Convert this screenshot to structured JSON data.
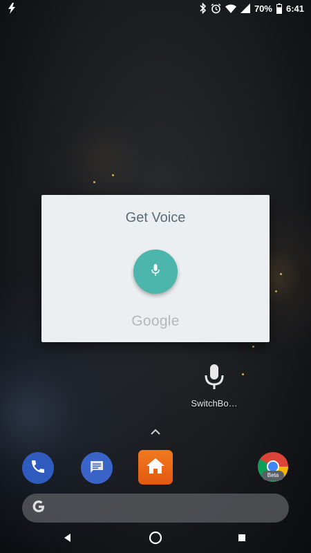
{
  "status_bar": {
    "battery_percent": "70%",
    "time": "6:41",
    "icons": [
      "flash-icon",
      "bluetooth-icon",
      "alarm-icon",
      "wifi-icon",
      "cell-signal-icon",
      "battery-icon"
    ]
  },
  "dialog": {
    "title": "Get Voice",
    "mic_icon": "microphone-icon",
    "mic_color": "#4db6ac",
    "logo_text": "Google"
  },
  "shortcut": {
    "label": "SwitchBo…",
    "icon": "microphone-icon"
  },
  "dock": {
    "apps": [
      {
        "name": "phone",
        "icon": "phone-icon",
        "color": "#2f5bbf"
      },
      {
        "name": "messages",
        "icon": "messages-icon",
        "color": "#3a64c8"
      },
      {
        "name": "home",
        "icon": "home-icon",
        "color": "#e3580f"
      },
      {
        "name": "chrome-beta",
        "icon": "chrome-icon",
        "badge": "Beta"
      }
    ]
  },
  "search_bar": {
    "icon": "google-g-icon"
  },
  "nav_bar": {
    "buttons": [
      "back-icon",
      "home-icon",
      "recents-icon"
    ]
  }
}
